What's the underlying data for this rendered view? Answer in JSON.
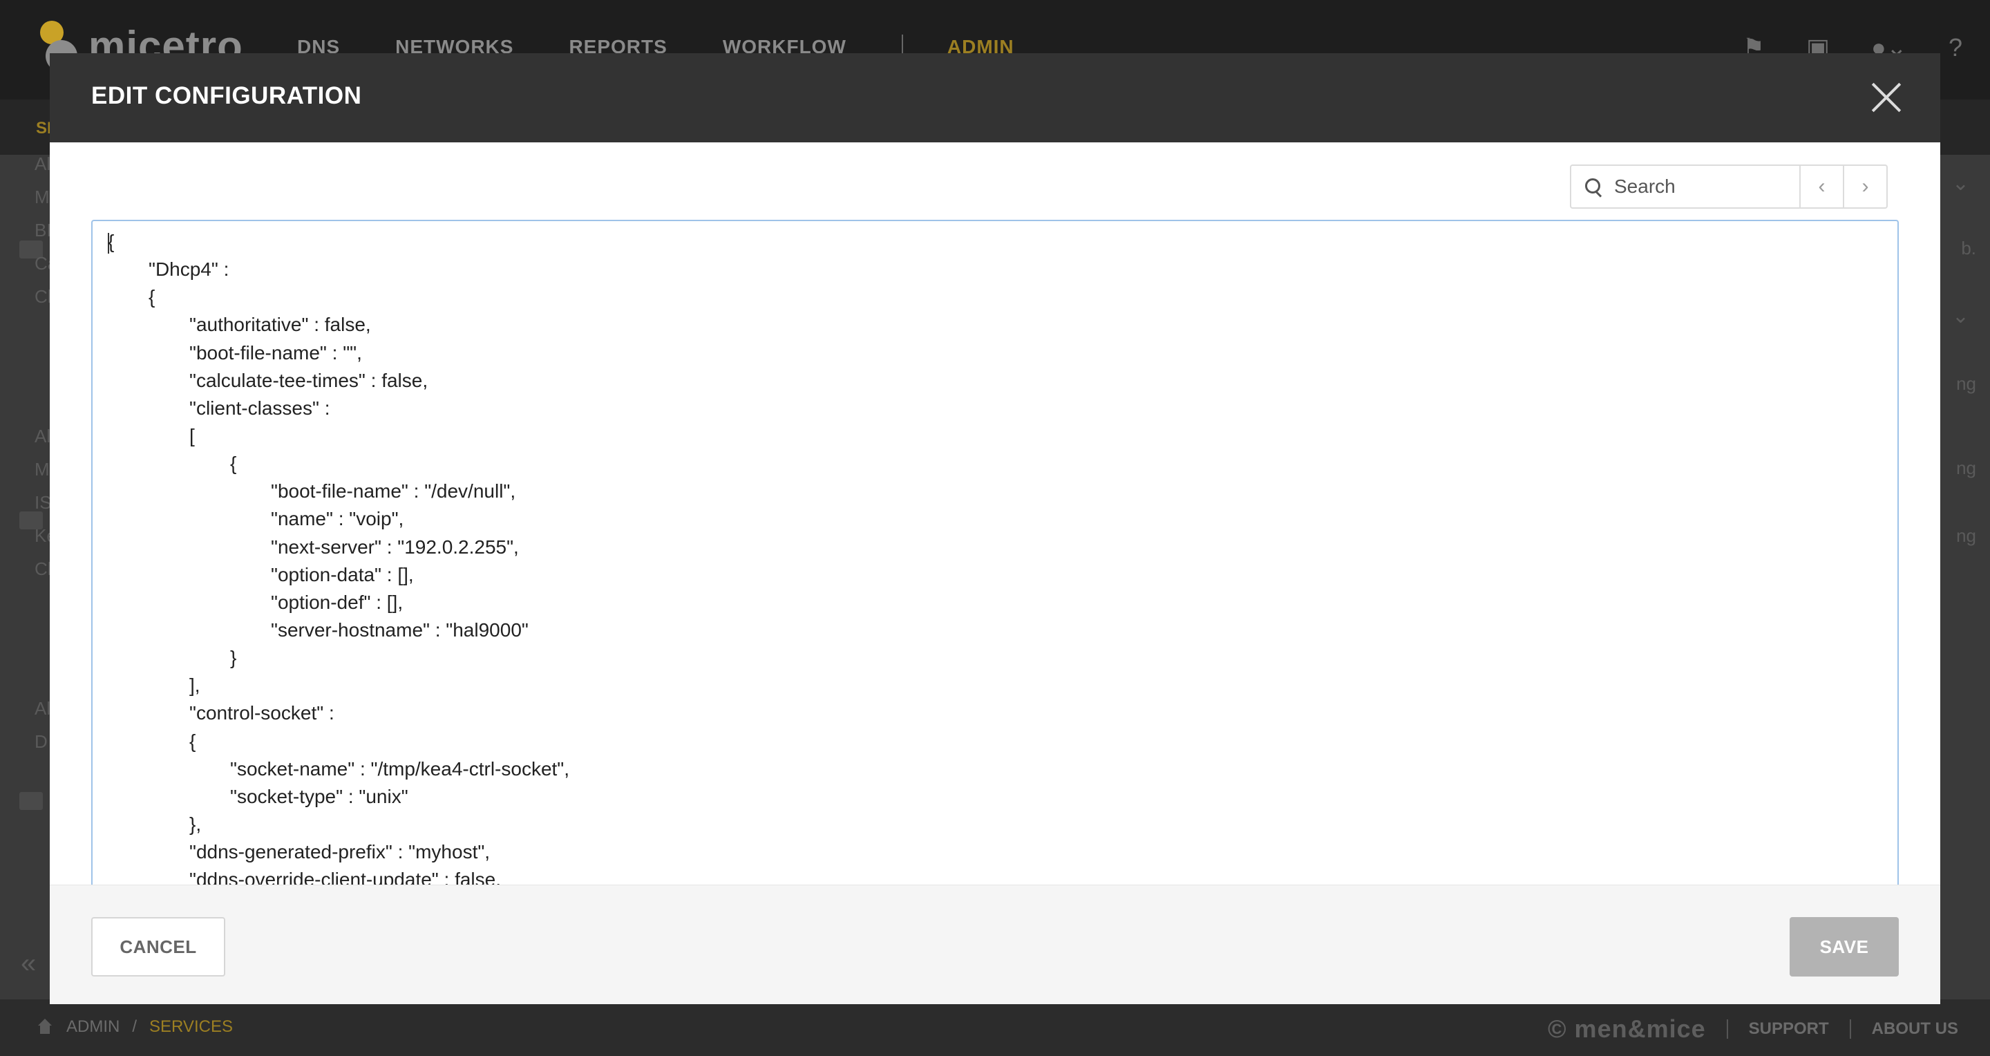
{
  "app": {
    "logo_text": "micetro",
    "nav": [
      "DNS",
      "NETWORKS",
      "REPORTS",
      "WORKFLOW",
      "ADMIN"
    ],
    "active_nav": "ADMIN",
    "subnav_text": "SE",
    "top_icons": [
      "flag-icon",
      "shield-icon",
      "user-icon",
      "help-icon"
    ]
  },
  "background_hints": {
    "left_labels": [
      "Al",
      "M",
      "BI",
      "Ca",
      "Cl",
      "Al",
      "M",
      "IS",
      "Ke",
      "Cl",
      "Al",
      "D"
    ],
    "right_labels": [
      "b.",
      "ng",
      "ng",
      "ng"
    ]
  },
  "footer": {
    "breadcrumb": [
      "ADMIN",
      "/",
      "SERVICES"
    ],
    "brand": "© men&mice",
    "links": [
      "SUPPORT",
      "ABOUT US"
    ]
  },
  "modal": {
    "title": "EDIT CONFIGURATION",
    "search_placeholder": "Search",
    "prev_label": "‹",
    "next_label": "›",
    "cancel_label": "CANCEL",
    "save_label": "SAVE",
    "code_lines": [
      "{",
      "\t\"Dhcp4\" :",
      "\t{",
      "\t\t\"authoritative\" : false,",
      "\t\t\"boot-file-name\" : \"\",",
      "\t\t\"calculate-tee-times\" : false,",
      "\t\t\"client-classes\" :",
      "\t\t[",
      "\t\t\t{",
      "\t\t\t\t\"boot-file-name\" : \"/dev/null\",",
      "\t\t\t\t\"name\" : \"voip\",",
      "\t\t\t\t\"next-server\" : \"192.0.2.255\",",
      "\t\t\t\t\"option-data\" : [],",
      "\t\t\t\t\"option-def\" : [],",
      "\t\t\t\t\"server-hostname\" : \"hal9000\"",
      "\t\t\t}",
      "\t\t],",
      "\t\t\"control-socket\" :",
      "\t\t{",
      "\t\t\t\"socket-name\" : \"/tmp/kea4-ctrl-socket\",",
      "\t\t\t\"socket-type\" : \"unix\"",
      "\t\t},",
      "\t\t\"ddns-generated-prefix\" : \"myhost\",",
      "\t\t\"ddns-override-client-update\" : false,"
    ]
  }
}
